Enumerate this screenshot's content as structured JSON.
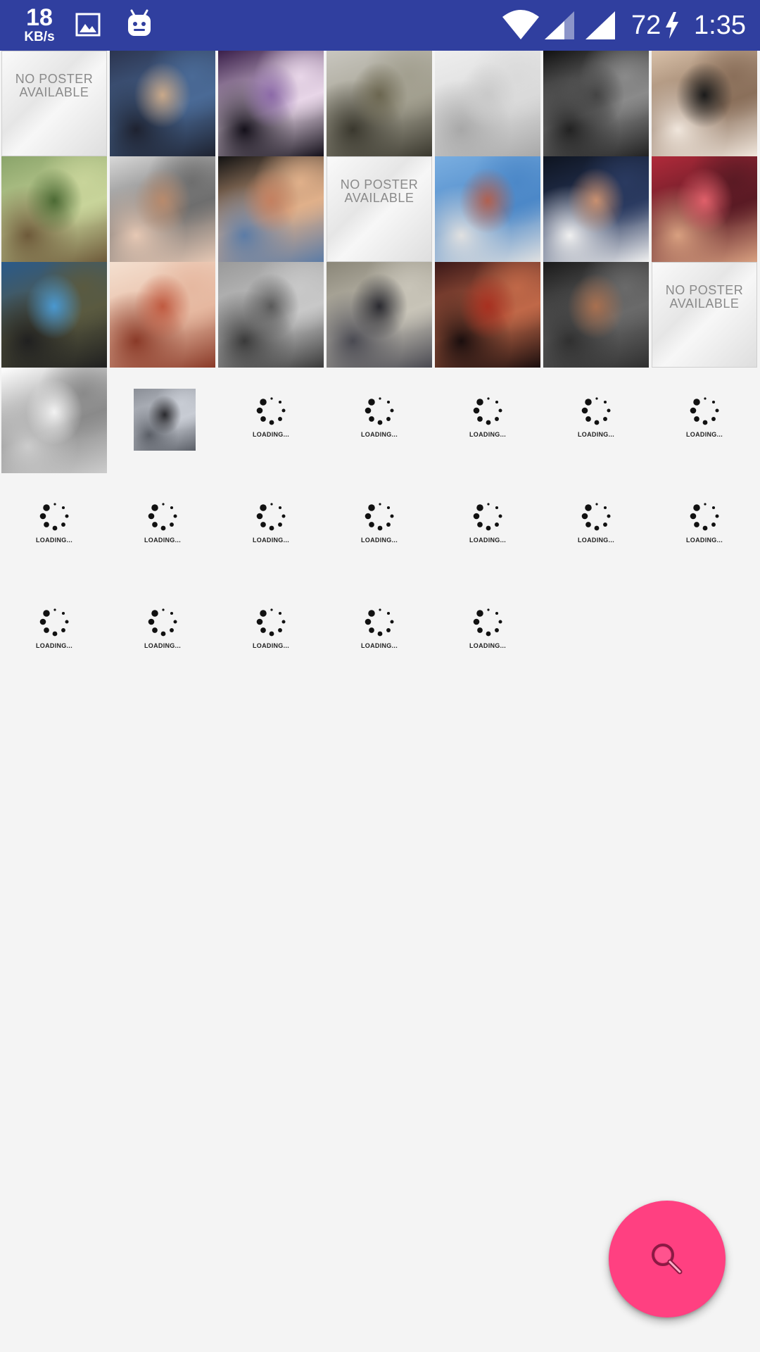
{
  "status_bar": {
    "speed_value": "18",
    "speed_unit": "KB/s",
    "battery_level": "72",
    "time": "1:35",
    "icons": [
      "gallery-icon",
      "android-icon",
      "wifi-icon",
      "signal-icon",
      "signal-icon",
      "charging-icon"
    ]
  },
  "grid": {
    "no_poster_label_line1": "NO POSTER",
    "no_poster_label_line2": "AVAILABLE",
    "loading_label": "LOADING...",
    "cells": [
      {
        "kind": "no-poster"
      },
      {
        "kind": "photo",
        "subject": "band-group",
        "palette": [
          "#2c3550",
          "#c9a98a",
          "#4a6a96",
          "#1e2230"
        ]
      },
      {
        "kind": "photo",
        "subject": "stage-performers",
        "palette": [
          "#3a1f4a",
          "#8c6aa8",
          "#e8d6e8",
          "#14101a"
        ]
      },
      {
        "kind": "photo",
        "subject": "theater-building",
        "palette": [
          "#c8c6bf",
          "#6b6650",
          "#a29f8f",
          "#3a382e"
        ]
      },
      {
        "kind": "photo",
        "subject": "newspaper-page",
        "palette": [
          "#eeeeee",
          "#c9c9c9",
          "#dadada",
          "#a8a8a8"
        ]
      },
      {
        "kind": "photo",
        "subject": "portrait-bw",
        "palette": [
          "#111111",
          "#444444",
          "#8a8a8a",
          "#222222"
        ]
      },
      {
        "kind": "photo",
        "subject": "man-in-suit",
        "palette": [
          "#d8c0a8",
          "#1a1a1a",
          "#8a6f5a",
          "#f0e6dc"
        ]
      },
      {
        "kind": "photo",
        "subject": "tree-painting",
        "palette": [
          "#8aa46a",
          "#4c6a34",
          "#c8d49a",
          "#6e5a3a"
        ]
      },
      {
        "kind": "photo",
        "subject": "older-man-microphone",
        "palette": [
          "#d8d8d8",
          "#b88a6c",
          "#6e6e6e",
          "#e6c8b4"
        ]
      },
      {
        "kind": "photo",
        "subject": "bearded-man-speaking",
        "palette": [
          "#121212",
          "#c48060",
          "#e0b08a",
          "#5c7ca6"
        ]
      },
      {
        "kind": "no-poster"
      },
      {
        "kind": "photo",
        "subject": "cartoon-sign",
        "palette": [
          "#7aaee0",
          "#b06050",
          "#4c88c8",
          "#e0e0e0"
        ]
      },
      {
        "kind": "photo",
        "subject": "man-at-panel",
        "palette": [
          "#0e1420",
          "#c89070",
          "#2a3a60",
          "#f0f0f0"
        ]
      },
      {
        "kind": "photo",
        "subject": "crowd-red",
        "palette": [
          "#b02a3a",
          "#e0606a",
          "#5a1a24",
          "#d8a080"
        ]
      },
      {
        "kind": "photo",
        "subject": "blue-train",
        "palette": [
          "#2a5a8a",
          "#4a98d0",
          "#5a5a40",
          "#202020"
        ]
      },
      {
        "kind": "photo",
        "subject": "old-building-sepia",
        "palette": [
          "#f4e0d0",
          "#c05a40",
          "#e6b8a0",
          "#8a3a28"
        ]
      },
      {
        "kind": "photo",
        "subject": "historic-crowd-bw",
        "palette": [
          "#9a9a9a",
          "#5a5a5a",
          "#c8c8c8",
          "#3a3a3a"
        ]
      },
      {
        "kind": "photo",
        "subject": "group-under-tree",
        "palette": [
          "#8a8678",
          "#2a2a30",
          "#c8c4b8",
          "#4a4a52"
        ]
      },
      {
        "kind": "photo",
        "subject": "red-scene",
        "palette": [
          "#3a1818",
          "#a83020",
          "#c06848",
          "#1a0e0e"
        ]
      },
      {
        "kind": "photo",
        "subject": "man-with-microphone",
        "palette": [
          "#1a1a1a",
          "#a87050",
          "#6a6a6a",
          "#303030"
        ]
      },
      {
        "kind": "no-poster"
      },
      {
        "kind": "photo",
        "subject": "text-document",
        "palette": [
          "#ffffff",
          "#f2f2f2",
          "#8a8a8a",
          "#cccccc"
        ]
      },
      {
        "kind": "small-photo",
        "subject": "street-car",
        "palette": [
          "#8a8e96",
          "#2a2a2e",
          "#c8ccd4",
          "#5a5e66"
        ]
      },
      {
        "kind": "loading"
      },
      {
        "kind": "loading"
      },
      {
        "kind": "loading"
      },
      {
        "kind": "loading"
      },
      {
        "kind": "loading"
      },
      {
        "kind": "loading"
      },
      {
        "kind": "loading"
      },
      {
        "kind": "loading"
      },
      {
        "kind": "loading"
      },
      {
        "kind": "loading"
      },
      {
        "kind": "loading"
      },
      {
        "kind": "loading"
      },
      {
        "kind": "loading"
      },
      {
        "kind": "loading"
      },
      {
        "kind": "loading"
      },
      {
        "kind": "loading"
      },
      {
        "kind": "loading"
      }
    ]
  },
  "fab": {
    "icon": "search-icon",
    "color": "#ff4081"
  },
  "colors": {
    "status_bar": "#303f9f",
    "background": "#f4f4f4"
  }
}
